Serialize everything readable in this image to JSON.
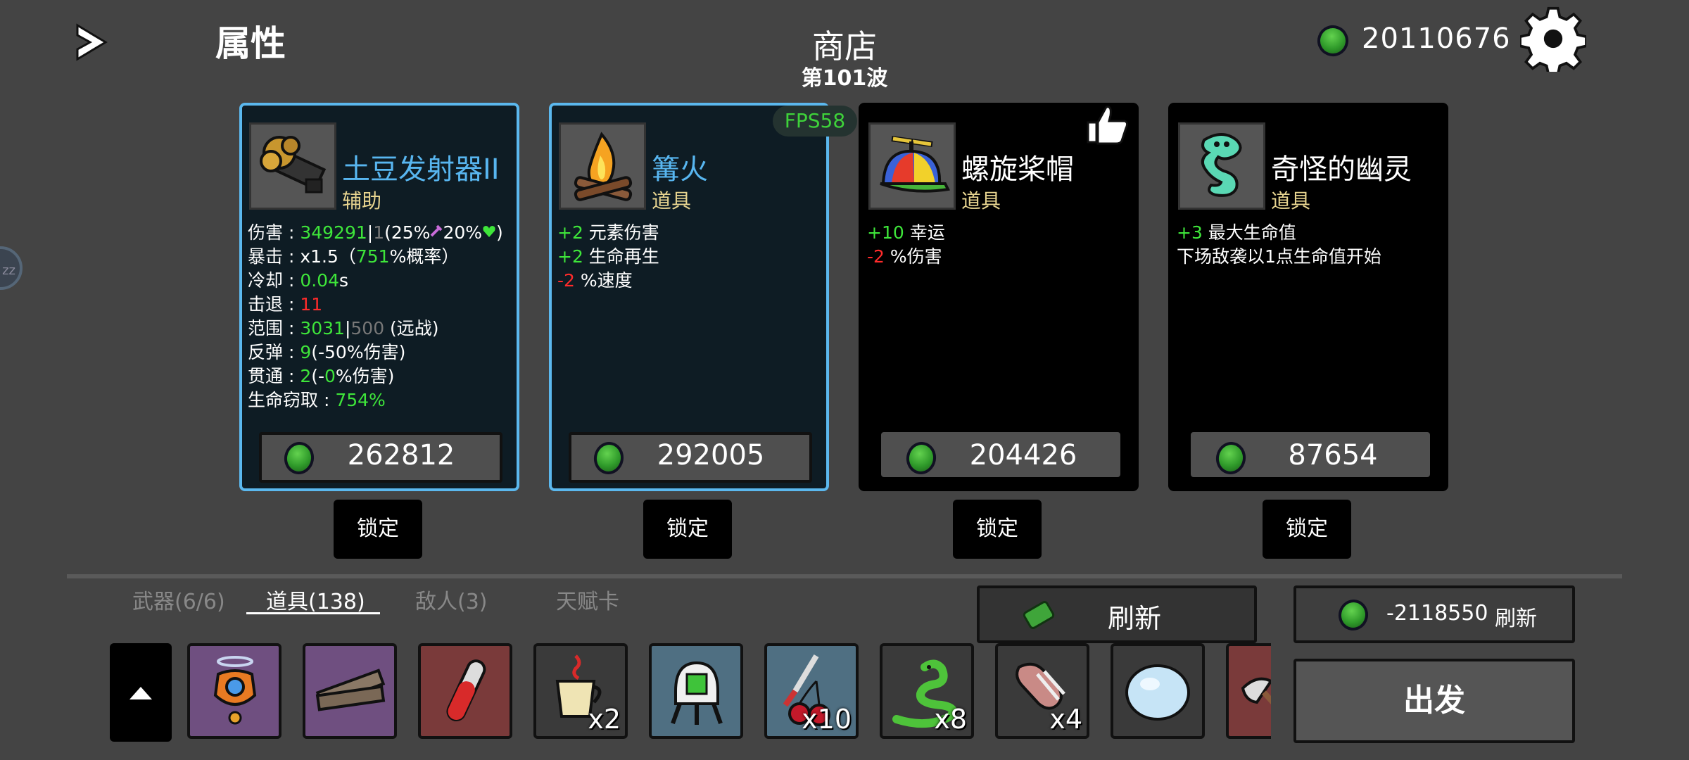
{
  "header": {
    "attributes_title": "属性",
    "shop_title": "商店",
    "wave": "第101波",
    "currency": "20110676"
  },
  "fps_label": "FPS58",
  "cards": [
    {
      "name": "土豆发射器II",
      "kind": "辅助",
      "selected": true,
      "name_color": "#58b6f0",
      "price": "262812",
      "lock_label": "锁定",
      "stats": {
        "damage_label": "伤害 : ",
        "damage_value": "349291",
        "damage_sep": "|",
        "damage_base": "1",
        "damage_open": "(25%",
        "damage_mid": "20%",
        "damage_close": ")",
        "crit_label": "暴击 :  x1.5（",
        "crit_value": "751",
        "crit_suffix": "%概率）",
        "cooldown_label": "冷却 : ",
        "cooldown_value": "0.04",
        "cooldown_unit": "s",
        "knockback_label": "击退 : ",
        "knockback_value": "11",
        "range_label": "范围 : ",
        "range_value": "3031",
        "range_sep": "|",
        "range_base": "500",
        "range_suffix": " (远战)",
        "bounce_label": "反弹 : ",
        "bounce_value": "9",
        "bounce_suffix": "(-50%伤害)",
        "pierce_label": "贯通 : ",
        "pierce_value": "2",
        "pierce_open": "(-",
        "pierce_pct": "0",
        "pierce_suffix": "%伤害)",
        "lifesteal_label": "生命窃取 : ",
        "lifesteal_value": "754%"
      }
    },
    {
      "name": "篝火",
      "kind": "道具",
      "selected": true,
      "name_color": "#58b6f0",
      "price": "292005",
      "lock_label": "锁定",
      "lines": [
        {
          "value": "+2",
          "color": "green",
          "text": " 元素伤害"
        },
        {
          "value": "+2",
          "color": "green",
          "text": " 生命再生"
        },
        {
          "value": "-2",
          "color": "red",
          "text": " %速度"
        }
      ]
    },
    {
      "name": "螺旋桨帽",
      "kind": "道具",
      "selected": false,
      "name_color": "#ffffff",
      "price": "204426",
      "lock_label": "锁定",
      "lines": [
        {
          "value": "+10",
          "color": "green",
          "text": " 幸运"
        },
        {
          "value": "-2",
          "color": "red",
          "text": " %伤害"
        }
      ]
    },
    {
      "name": "奇怪的幽灵",
      "kind": "道具",
      "selected": false,
      "name_color": "#ffffff",
      "price": "87654",
      "lock_label": "锁定",
      "lines": [
        {
          "value": "+3",
          "color": "green",
          "text": " 最大生命值"
        },
        {
          "value": "",
          "color": "white",
          "text": "下场敌袭以1点生命值开始"
        }
      ]
    }
  ],
  "tabs": [
    {
      "label": "武器(6/6)",
      "active": false
    },
    {
      "label": "道具(138)",
      "active": true
    },
    {
      "label": "敌人(3)",
      "active": false
    },
    {
      "label": "天赋卡",
      "active": false
    }
  ],
  "refresh_button_label": "刷新",
  "reroll": {
    "cost": "-2118550",
    "label": "刷新"
  },
  "go_button_label": "出发",
  "inventory": [
    {
      "icon": "drone-icon",
      "bg": "#6f4f80",
      "count": ""
    },
    {
      "icon": "wood-planks-icon",
      "bg": "#6f4f80",
      "count": ""
    },
    {
      "icon": "test-tube-icon",
      "bg": "#7a3a3a",
      "count": ""
    },
    {
      "icon": "coffee-cup-icon",
      "bg": "#3a3a3a",
      "count": "x2"
    },
    {
      "icon": "medic-robot-icon",
      "bg": "#4f6f82",
      "count": ""
    },
    {
      "icon": "cherry-knife-icon",
      "bg": "#4f6f82",
      "count": "x10"
    },
    {
      "icon": "snake-icon",
      "bg": "#3a3a3a",
      "count": "x8"
    },
    {
      "icon": "bone-meat-icon",
      "bg": "#3a3a3a",
      "count": "x4"
    },
    {
      "icon": "snowball-icon",
      "bg": "#3a3a3a",
      "count": ""
    },
    {
      "icon": "axe-icon",
      "bg": "#7a3a3a",
      "count": ""
    }
  ]
}
